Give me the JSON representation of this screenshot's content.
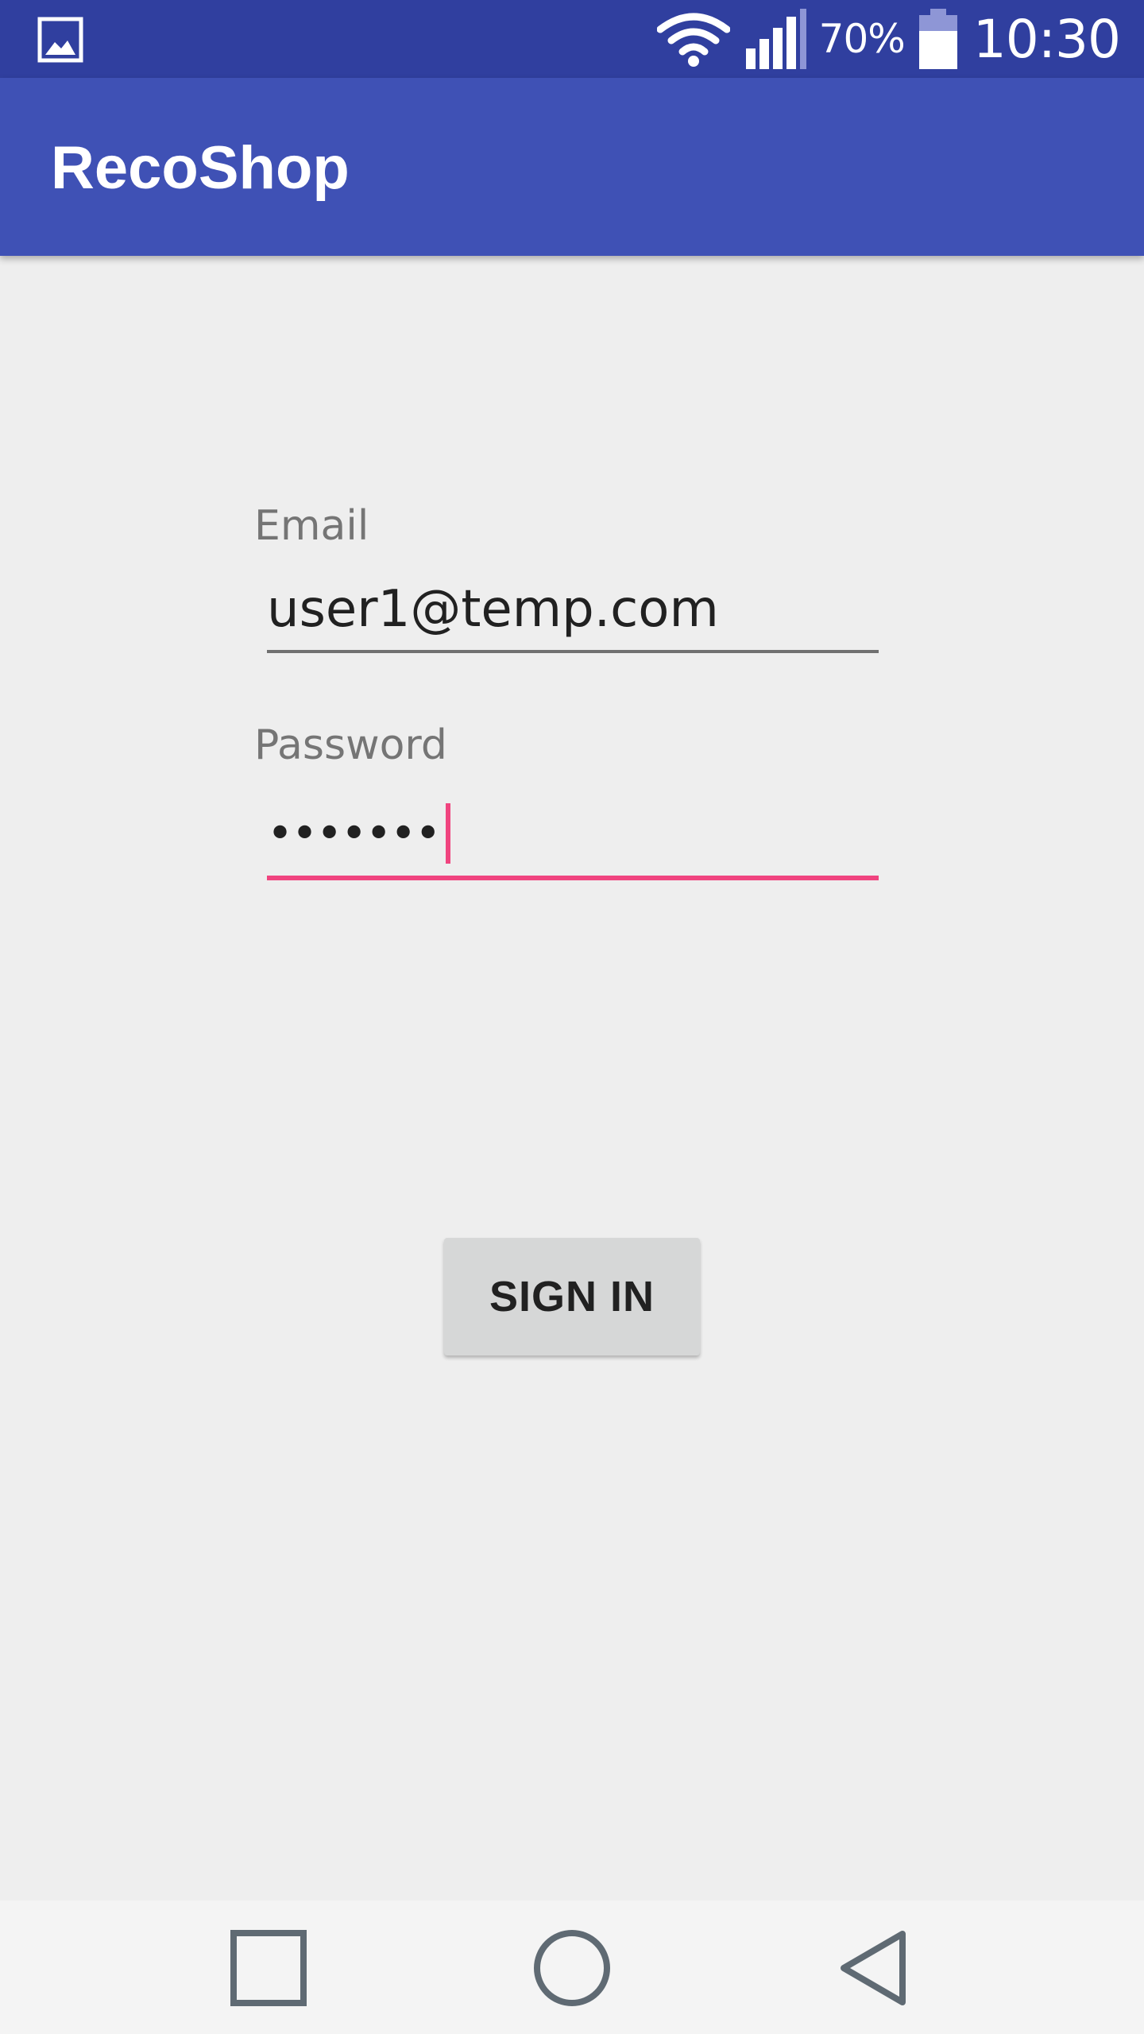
{
  "status_bar": {
    "notification_icon": "image-icon",
    "wifi_icon": "wifi-icon",
    "signal_icon": "signal-icon",
    "battery_percent": "70%",
    "battery_icon": "battery-icon",
    "battery_level": 0.7,
    "time": "10:30",
    "color": "#303f9f"
  },
  "app_bar": {
    "title": "RecoShop",
    "color": "#3f51b5"
  },
  "form": {
    "email_label": "Email",
    "email_value": "user1@temp.com",
    "password_label": "Password",
    "password_masked": "•••••••",
    "sign_in_label": "SIGN IN",
    "accent_color": "#f0447f"
  },
  "nav_bar": {
    "recents_icon": "square-icon",
    "home_icon": "circle-icon",
    "back_icon": "triangle-back-icon"
  }
}
